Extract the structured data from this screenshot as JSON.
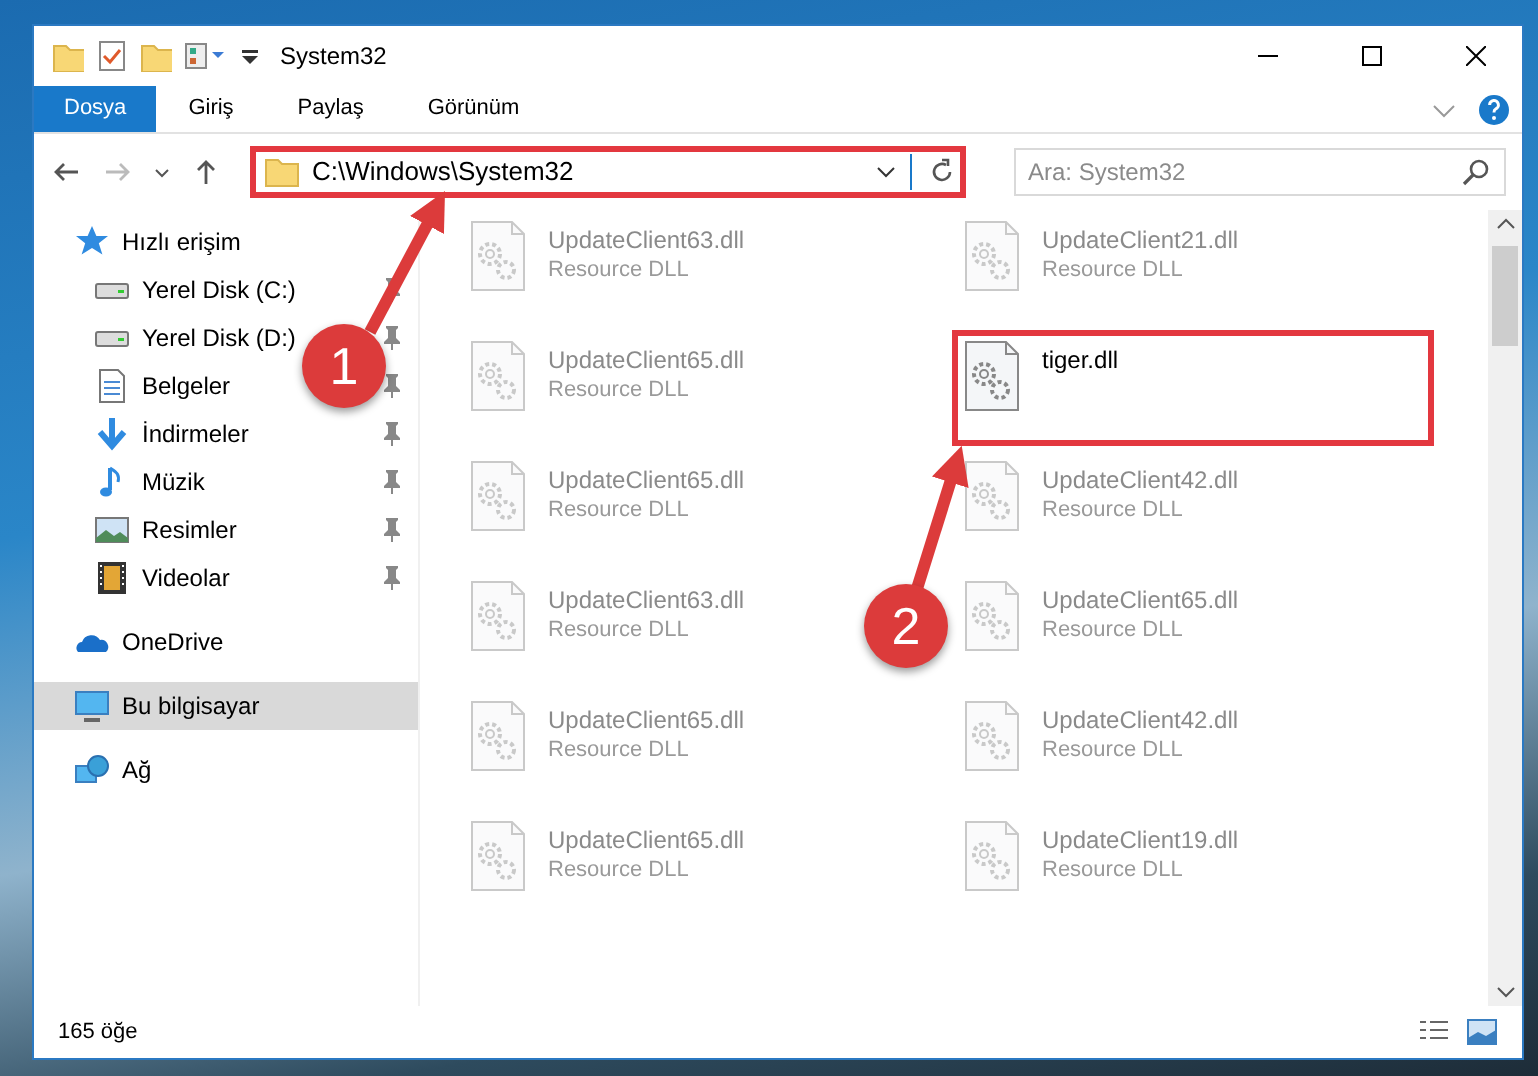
{
  "window": {
    "title": "System32"
  },
  "ribbon_tabs": [
    {
      "label": "Dosya",
      "selected": true
    },
    {
      "label": "Giriş",
      "selected": false
    },
    {
      "label": "Paylaş",
      "selected": false
    },
    {
      "label": "Görünüm",
      "selected": false
    }
  ],
  "address_bar": {
    "path": "C:\\Windows\\System32",
    "highlighted": true
  },
  "search": {
    "placeholder": "Ara: System32"
  },
  "sidebar": {
    "items": [
      {
        "label": "Hızlı erişim",
        "kind": "star",
        "pinned": false,
        "selected": false,
        "children": [
          {
            "label": "Yerel Disk (C:)",
            "kind": "drive",
            "pinned": true,
            "selected": false
          },
          {
            "label": "Yerel Disk (D:)",
            "kind": "drive",
            "pinned": true,
            "selected": false
          },
          {
            "label": "Belgeler",
            "kind": "document",
            "pinned": true,
            "selected": false
          },
          {
            "label": "İndirmeler",
            "kind": "download",
            "pinned": true,
            "selected": false
          },
          {
            "label": "Müzik",
            "kind": "music",
            "pinned": true,
            "selected": false
          },
          {
            "label": "Resimler",
            "kind": "picture",
            "pinned": true,
            "selected": false
          },
          {
            "label": "Videolar",
            "kind": "video",
            "pinned": true,
            "selected": false
          }
        ]
      },
      {
        "label": "OneDrive",
        "kind": "cloud",
        "pinned": false,
        "selected": false
      },
      {
        "label": "Bu bilgisayar",
        "kind": "computer",
        "pinned": false,
        "selected": true
      },
      {
        "label": "Ağ",
        "kind": "network",
        "pinned": false,
        "selected": false
      }
    ]
  },
  "files": [
    {
      "name": "UpdateClient63.dll",
      "type": "Resource DLL",
      "blurred": true,
      "highlighted": false
    },
    {
      "name": "UpdateClient21.dll",
      "type": "Resource DLL",
      "blurred": true,
      "highlighted": false
    },
    {
      "name": "UpdateClient65.dll",
      "type": "Resource DLL",
      "blurred": true,
      "highlighted": false
    },
    {
      "name": "tiger.dll",
      "blurred": false,
      "highlighted": true
    },
    {
      "name": "UpdateClient65.dll",
      "type": "Resource DLL",
      "blurred": true,
      "highlighted": false
    },
    {
      "name": "UpdateClient42.dll",
      "type": "Resource DLL",
      "blurred": true,
      "highlighted": false
    },
    {
      "name": "UpdateClient63.dll",
      "type": "Resource DLL",
      "blurred": true,
      "highlighted": false
    },
    {
      "name": "UpdateClient65.dll",
      "type": "Resource DLL",
      "blurred": true,
      "highlighted": false
    },
    {
      "name": "UpdateClient65.dll",
      "type": "Resource DLL",
      "blurred": true,
      "highlighted": false
    },
    {
      "name": "UpdateClient42.dll",
      "type": "Resource DLL",
      "blurred": true,
      "highlighted": false
    },
    {
      "name": "UpdateClient65.dll",
      "type": "Resource DLL",
      "blurred": true,
      "highlighted": false
    },
    {
      "name": "UpdateClient19.dll",
      "type": "Resource DLL",
      "blurred": true,
      "highlighted": false
    }
  ],
  "status_bar": {
    "count": "165 öğe"
  },
  "annotations": [
    {
      "number": "1"
    },
    {
      "number": "2"
    }
  ]
}
